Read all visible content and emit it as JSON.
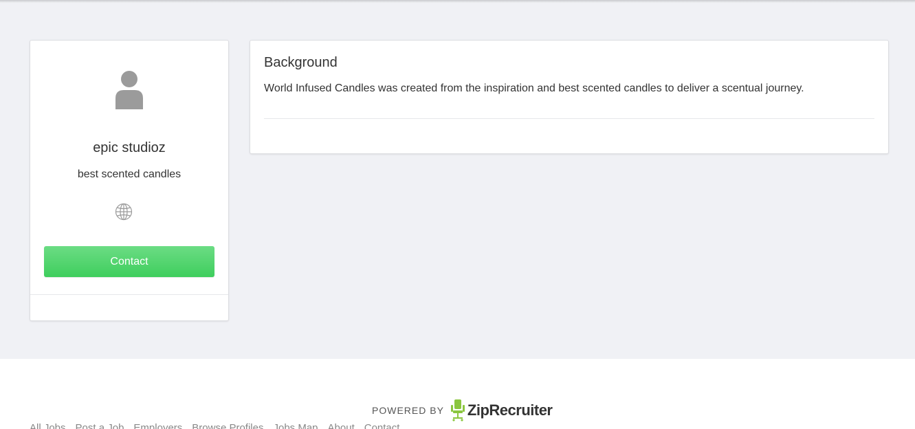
{
  "profile": {
    "avatar_icon": "user-silhouette-icon",
    "company_name": "epic studioz",
    "tagline": "best scented candles",
    "website_icon": "globe-icon",
    "contact_label": "Contact"
  },
  "background": {
    "title": "Background",
    "body": "World Infused Candles was created from the inspiration and best scented candles to deliver a scentual journey."
  },
  "footer": {
    "powered_by": "POWERED BY",
    "brand": "ZipRecruiter",
    "links": [
      "All Jobs",
      "Post a Job",
      "Employers",
      "Browse Profiles",
      "Jobs Map",
      "About",
      "Contact"
    ]
  },
  "colors": {
    "page_background": "#f0f1f5",
    "contact_button": "#4cd26a",
    "brand_accent": "#8bc63f"
  }
}
